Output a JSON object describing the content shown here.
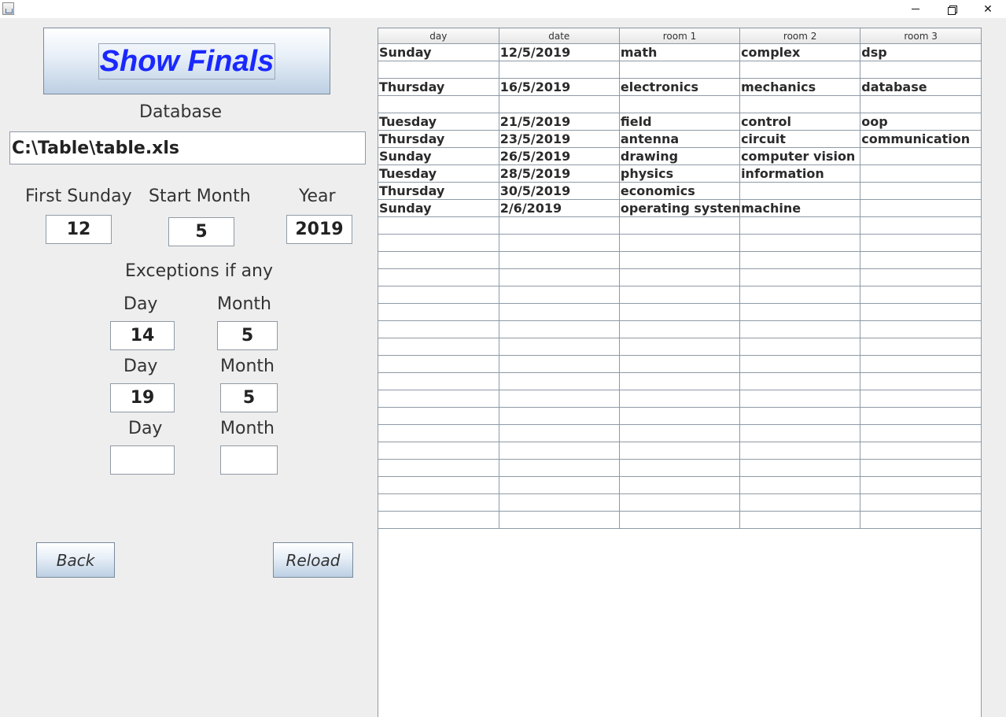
{
  "window": {
    "app_icon": "java-cup-icon",
    "controls": [
      "minimize-icon",
      "maximize-icon",
      "close-icon"
    ]
  },
  "left_panel": {
    "show_finals_label": "Show Finals",
    "database_label": "Database",
    "database_path": "C:\\Table\\table.xls",
    "first_sunday_label": "First Sunday",
    "first_sunday_value": "12",
    "start_month_label": "Start Month",
    "start_month_value": "5",
    "year_label": "Year",
    "year_value": "2019",
    "exceptions_label": "Exceptions if any",
    "exceptions": [
      {
        "day_label": "Day",
        "month_label": "Month",
        "day_value": "14",
        "month_value": "5"
      },
      {
        "day_label": "Day",
        "month_label": "Month",
        "day_value": "19",
        "month_value": "5"
      },
      {
        "day_label": "Day",
        "month_label": "Month",
        "day_value": "",
        "month_value": ""
      }
    ],
    "back_label": "Back",
    "reload_label": "Reload"
  },
  "table": {
    "columns": [
      "day",
      "date",
      "room 1",
      "room 2",
      "room 3"
    ],
    "rows": [
      [
        "Sunday",
        "12/5/2019",
        "math",
        "complex",
        "dsp"
      ],
      [
        "",
        "",
        "",
        "",
        ""
      ],
      [
        "Thursday",
        "16/5/2019",
        "electronics",
        "mechanics",
        "database"
      ],
      [
        "",
        "",
        "",
        "",
        ""
      ],
      [
        "Tuesday",
        "21/5/2019",
        "field",
        "control",
        "oop"
      ],
      [
        "Thursday",
        "23/5/2019",
        "antenna",
        "circuit",
        "communication"
      ],
      [
        "Sunday",
        "26/5/2019",
        "drawing",
        "computer vision",
        ""
      ],
      [
        "Tuesday",
        "28/5/2019",
        "physics",
        "information",
        ""
      ],
      [
        "Thursday",
        "30/5/2019",
        "economics",
        "",
        ""
      ],
      [
        "Sunday",
        "2/6/2019",
        "operating systems",
        "machine",
        ""
      ],
      [
        "",
        "",
        "",
        "",
        ""
      ],
      [
        "",
        "",
        "",
        "",
        ""
      ],
      [
        "",
        "",
        "",
        "",
        ""
      ],
      [
        "",
        "",
        "",
        "",
        ""
      ],
      [
        "",
        "",
        "",
        "",
        ""
      ],
      [
        "",
        "",
        "",
        "",
        ""
      ],
      [
        "",
        "",
        "",
        "",
        ""
      ],
      [
        "",
        "",
        "",
        "",
        ""
      ],
      [
        "",
        "",
        "",
        "",
        ""
      ],
      [
        "",
        "",
        "",
        "",
        ""
      ],
      [
        "",
        "",
        "",
        "",
        ""
      ],
      [
        "",
        "",
        "",
        "",
        ""
      ],
      [
        "",
        "",
        "",
        "",
        ""
      ],
      [
        "",
        "",
        "",
        "",
        ""
      ],
      [
        "",
        "",
        "",
        "",
        ""
      ],
      [
        "",
        "",
        "",
        "",
        ""
      ],
      [
        "",
        "",
        "",
        "",
        ""
      ],
      [
        "",
        "",
        "",
        "",
        ""
      ]
    ]
  }
}
